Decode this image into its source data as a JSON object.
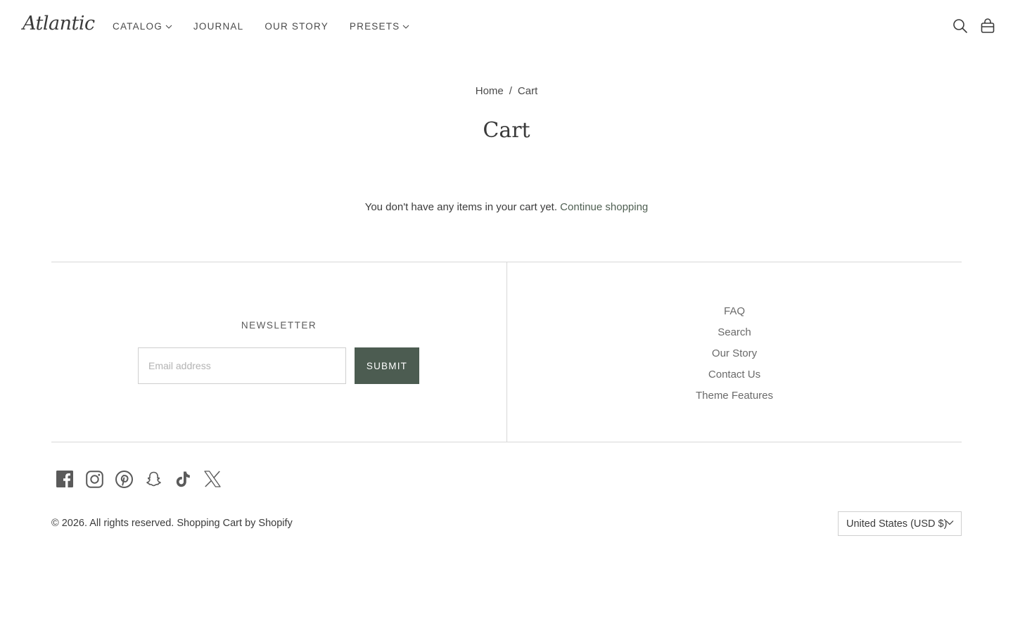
{
  "brand": {
    "logo_text": "Atlantic"
  },
  "nav": {
    "items": [
      {
        "label": "CATALOG",
        "has_dropdown": true
      },
      {
        "label": "JOURNAL",
        "has_dropdown": false
      },
      {
        "label": "OUR STORY",
        "has_dropdown": false
      },
      {
        "label": "PRESETS",
        "has_dropdown": true
      }
    ]
  },
  "header_icons": [
    "search-icon",
    "bag-icon"
  ],
  "breadcrumb": {
    "home": "Home",
    "separator": "/",
    "current": "Cart"
  },
  "page": {
    "title": "Cart",
    "empty_message": "You don't have any items in your cart yet.",
    "continue_link": "Continue shopping"
  },
  "newsletter": {
    "title": "NEWSLETTER",
    "email_placeholder": "Email address",
    "email_value": "",
    "submit_label": "SUBMIT"
  },
  "footer_links": [
    "FAQ",
    "Search",
    "Our Story",
    "Contact Us",
    "Theme Features"
  ],
  "social_icons": [
    "facebook-icon",
    "instagram-icon",
    "pinterest-icon",
    "snapchat-icon",
    "tiktok-icon",
    "x-icon"
  ],
  "copyright": {
    "text": "© 2026. All rights reserved.",
    "link": "Shopping Cart by Shopify"
  },
  "currency": {
    "selected": "United States (USD $)"
  },
  "colors": {
    "accent": "#4c5c51",
    "text": "#3b3b3b",
    "border": "#d8d8d8"
  }
}
